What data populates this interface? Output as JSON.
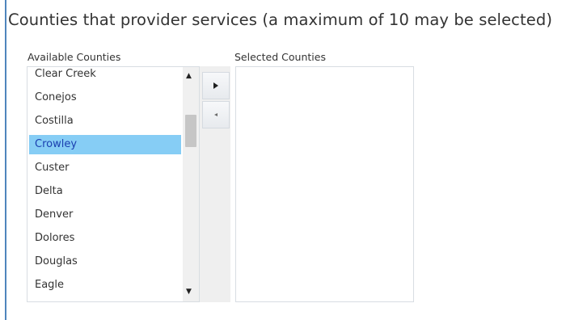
{
  "header": {
    "title": "Counties that provider services (a maximum of 10 may be selected)"
  },
  "available": {
    "label": "Available Counties",
    "items": [
      {
        "name": "Clear Creek"
      },
      {
        "name": "Conejos"
      },
      {
        "name": "Costilla"
      },
      {
        "name": "Crowley",
        "selected": true
      },
      {
        "name": "Custer"
      },
      {
        "name": "Delta"
      },
      {
        "name": "Denver"
      },
      {
        "name": "Dolores"
      },
      {
        "name": "Douglas"
      },
      {
        "name": "Eagle"
      }
    ],
    "scroll": {
      "up_icon": "triangle-up-icon",
      "down_icon": "triangle-down-icon"
    }
  },
  "controls": {
    "add_icon": "arrow-right-icon",
    "remove_icon": "arrow-left-icon"
  },
  "selected": {
    "label": "Selected Counties",
    "items": []
  },
  "colors": {
    "frame_border": "#4f85bd",
    "selected_bg": "#86cdf5",
    "selected_text": "#1a3fb0"
  }
}
